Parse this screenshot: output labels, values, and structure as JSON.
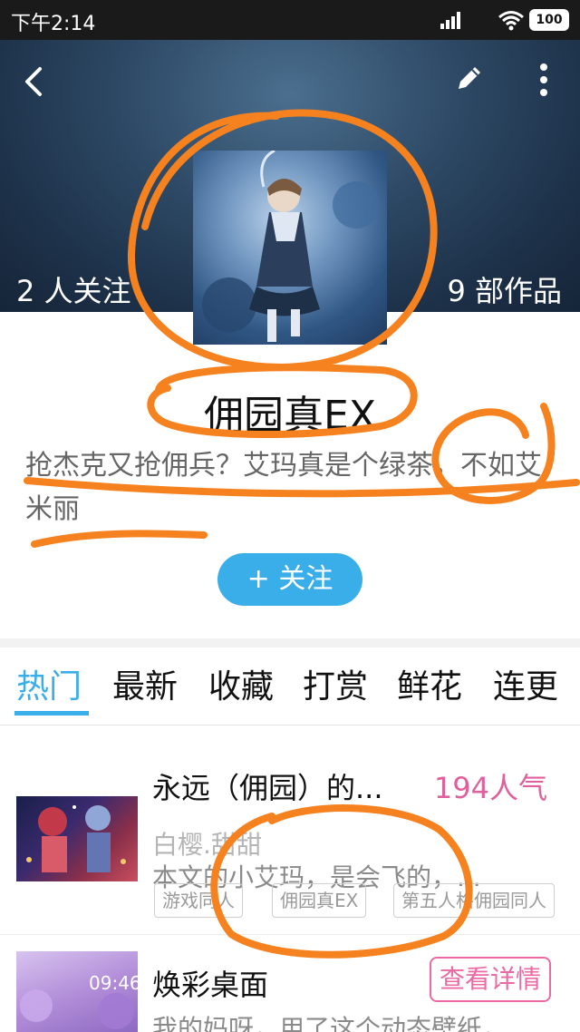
{
  "status_bar": {
    "time": "下午2:14",
    "battery": "100"
  },
  "header": {
    "follow_count": "2 人关注",
    "works_count": "9 部作品"
  },
  "profile": {
    "name": "佣园真EX",
    "bio": "抢杰克又抢佣兵？艾玛真是个绿茶，不如艾米丽",
    "follow_button": "+ 关注"
  },
  "tabs": [
    {
      "label": "热门",
      "active": true
    },
    {
      "label": "最新"
    },
    {
      "label": "收藏"
    },
    {
      "label": "打赏"
    },
    {
      "label": "鲜花"
    },
    {
      "label": "连更"
    }
  ],
  "items": [
    {
      "title": "永远（佣园）的...",
      "popularity": "194人气",
      "author": "白樱.甜甜",
      "desc": "本文的小艾玛，是会飞的，...",
      "tags": [
        "游戏同人",
        "佣园真EX",
        "第五人格佣园同人"
      ]
    },
    {
      "title": "焕彩桌面",
      "detail_button": "查看详情",
      "desc": "我的妈呀，用了这个动态壁纸，",
      "thumb_time": "09:46"
    }
  ],
  "colors": {
    "accent": "#3aaee8",
    "pink": "#e0609c",
    "annotation": "#f5821f"
  }
}
